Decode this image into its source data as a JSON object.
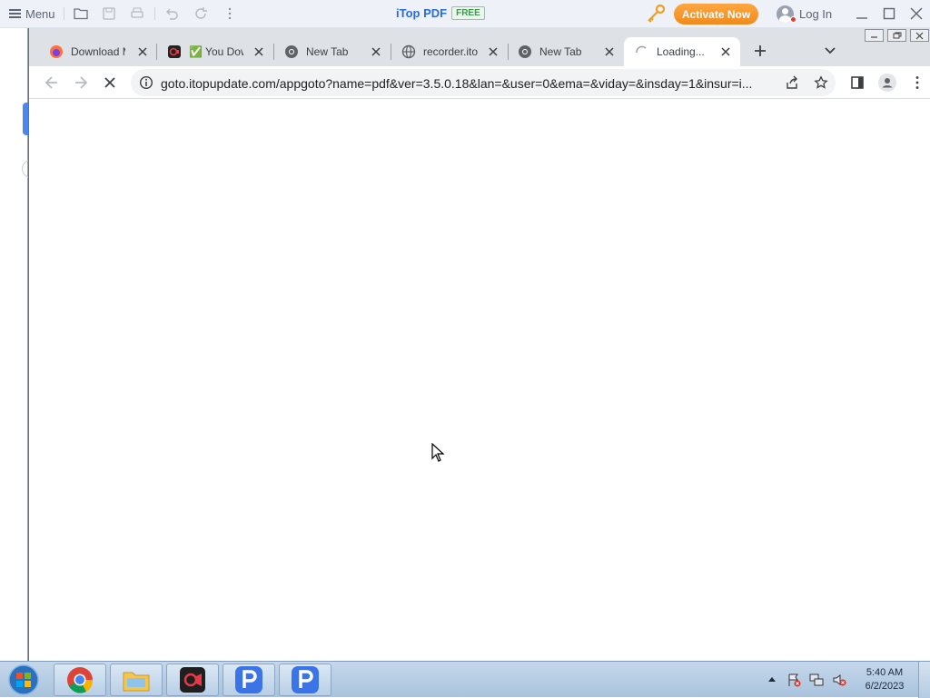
{
  "itop": {
    "menu_label": "Menu",
    "app_title": "iTop PDF",
    "free_badge": "FREE",
    "activate_label": "Activate Now",
    "login_label": "Log In",
    "accent": "#2b6cd9",
    "activate_color": "#f39a2b"
  },
  "chrome": {
    "tabs": [
      {
        "title": "Download M",
        "icon": "firefox-icon"
      },
      {
        "title": "✅ You Down",
        "icon": "recorder-icon"
      },
      {
        "title": "New Tab",
        "icon": "chrome-icon"
      },
      {
        "title": "recorder.itop",
        "icon": "globe-icon"
      },
      {
        "title": "New Tab",
        "icon": "chrome-icon"
      },
      {
        "title": "Loading...",
        "icon": "loading-spinner-icon",
        "active": true
      }
    ],
    "url": "goto.itopupdate.com/appgoto?name=pdf&ver=3.5.0.18&lan=&user=0&ema=&viday=&insday=1&insur=i..."
  },
  "taskbar": {
    "items": [
      "chrome-icon",
      "file-explorer-icon",
      "screen-recorder-icon",
      "itop-pdf-icon",
      "itop-pdf-icon"
    ],
    "time": "5:40 AM",
    "date": "6/2/2023"
  }
}
